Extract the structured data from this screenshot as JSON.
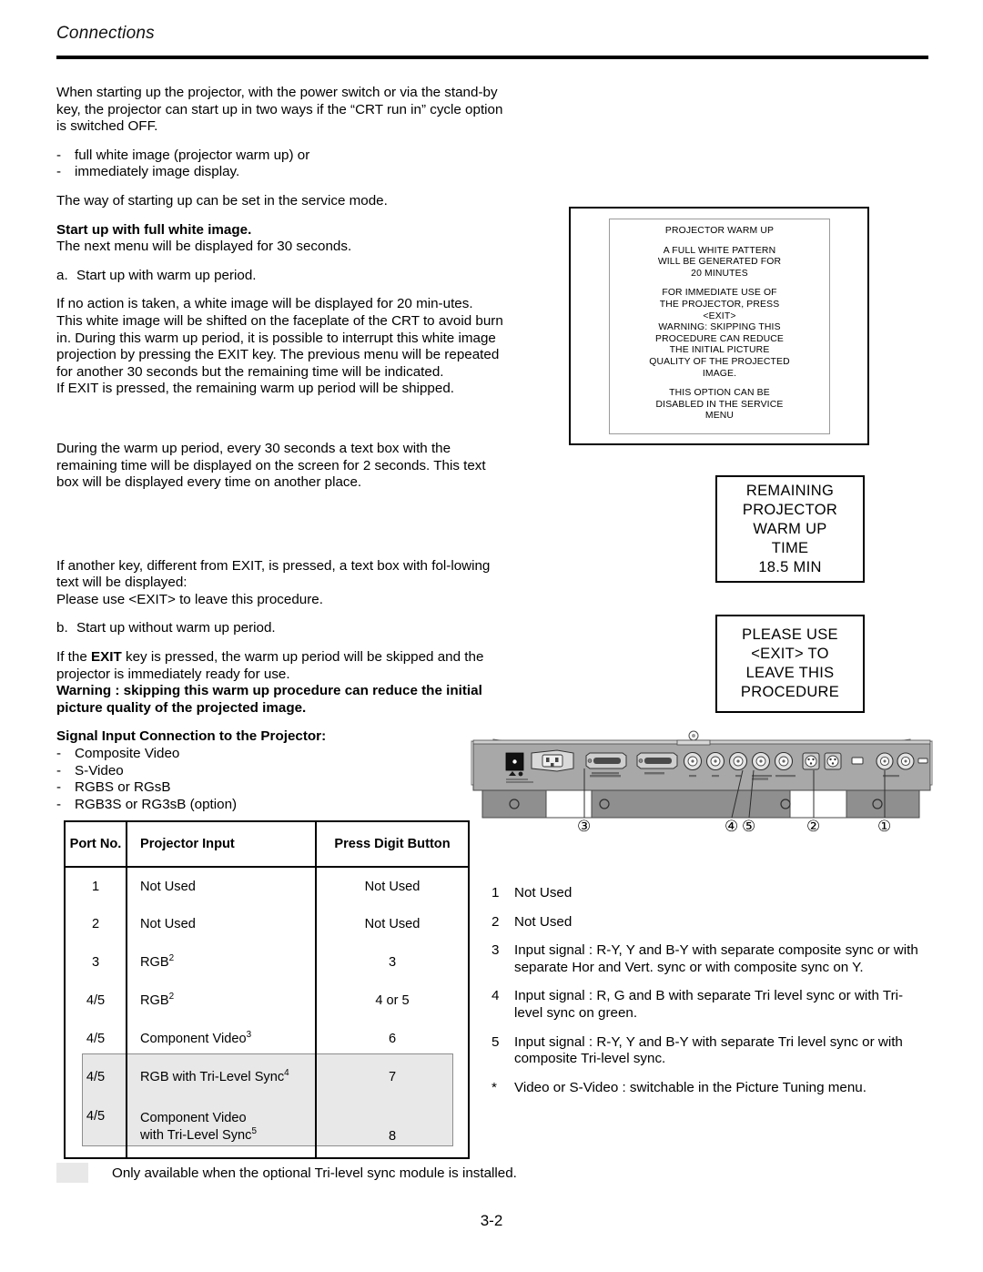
{
  "header": {
    "chapter": "Connections"
  },
  "body": {
    "intro": "When starting up the projector, with the power switch or via the stand-by key, the projector can start up in two ways if the “CRT run in” cycle option is switched OFF.",
    "intro_items": [
      "full white image (projector warm up) or",
      "immediately image display."
    ],
    "service_mode": "The way of starting up can be set in the service mode.",
    "heading_full_white": "Start up with full white image.",
    "next_menu": "The next menu will be displayed for 30 seconds.",
    "item_a_letter": "a.",
    "item_a_text": "Start up with warm up period.",
    "para_no_action": "If no action is taken, a white image will be displayed for 20 min-utes.",
    "para_shift": "This white image will be shifted on the faceplate of the CRT to avoid burn in. During this warm up period, it is possible to interrupt this white image projection by pressing the EXIT key. The previous menu will be repeated for another 30 seconds but the remaining time will be indicated.",
    "para_exit_shipped": "If EXIT is pressed, the remaining warm up period will be shipped.",
    "para_every30": "During the warm up period, every 30 seconds a text box with the remaining time will be displayed on the screen for 2 seconds. This text box will be displayed every time on another place.",
    "para_another_key": "If another key, different from EXIT, is pressed, a text box with fol-lowing text will be displayed:",
    "para_please_use": "Please use <EXIT> to leave this procedure.",
    "item_b_letter": "b.",
    "item_b_text": "Start up without warm up period.",
    "para_exit_pressed_pre": "If the ",
    "para_exit_pressed_bold": "EXIT",
    "para_exit_pressed_post": " key is pressed, the warm up period will be skipped and the projector is immediately ready for use.",
    "warning_bold": "Warning : skipping this warm up procedure can reduce the initial picture quality of the projected image.",
    "signal_heading": "Signal Input Connection to the Projector:",
    "signal_items": [
      "Composite Video",
      "S-Video",
      "RGBS or RGsB",
      "RGB3S or RG3sB (option)"
    ]
  },
  "warmup_menu": {
    "title": "PROJECTOR WARM UP",
    "block1": [
      "A FULL WHITE PATTERN",
      "WILL BE GENERATED FOR",
      "20 MINUTES"
    ],
    "block2": [
      "FOR IMMEDIATE USE OF",
      "THE PROJECTOR, PRESS",
      "<EXIT>",
      "WARNING: SKIPPING THIS",
      "PROCEDURE CAN REDUCE",
      "THE INITIAL PICTURE",
      "QUALITY OF THE PROJECTED",
      "IMAGE."
    ],
    "block3": [
      "THIS OPTION CAN BE",
      "DISABLED IN THE SERVICE",
      "MENU"
    ]
  },
  "osd_remaining": {
    "lines": [
      "REMAINING",
      "PROJECTOR",
      "WARM UP",
      "TIME",
      "18.5 MIN"
    ]
  },
  "osd_please_use": {
    "lines": [
      "PLEASE USE",
      "<EXIT> TO",
      "LEAVE THIS",
      "PROCEDURE"
    ]
  },
  "panel_figure": {
    "callouts": [
      "③",
      "④",
      "⑤",
      "②",
      "①"
    ]
  },
  "table": {
    "headers": [
      "Port No.",
      "Projector Input",
      "Press Digit Button"
    ],
    "rows": [
      {
        "port": "1",
        "input": "Not Used",
        "input_sup": "",
        "digit": "Not Used",
        "shaded": false
      },
      {
        "port": "2",
        "input": "Not Used",
        "input_sup": "",
        "digit": "Not Used",
        "shaded": false
      },
      {
        "port": "3",
        "input": "RGB",
        "input_sup": "2",
        "digit": "3",
        "shaded": false
      },
      {
        "port": "4/5",
        "input": "RGB",
        "input_sup": "2",
        "digit": "4 or 5",
        "shaded": false
      },
      {
        "port": "4/5",
        "input": "Component Video",
        "input_sup": "3",
        "digit": "6",
        "shaded": false
      },
      {
        "port": "4/5",
        "input": "RGB with Tri-Level Sync",
        "input_sup": "4",
        "digit": "7",
        "shaded": true
      },
      {
        "port": "4/5",
        "input": "Component Video",
        "input_sup": "",
        "input_line2": "with Tri-Level Sync",
        "input_line2_sup": "5",
        "digit": "8",
        "shaded": true
      }
    ]
  },
  "notes": [
    {
      "num": "1",
      "text": "Not Used"
    },
    {
      "num": "2",
      "text": "Not Used"
    },
    {
      "num": "3",
      "text": "Input signal : R-Y, Y and B-Y with separate composite sync or with separate Hor and Vert. sync or with composite sync on Y."
    },
    {
      "num": "4",
      "text": "Input signal : R, G and B with separate Tri level sync or with Tri-level sync on green."
    },
    {
      "num": "5",
      "text": "Input signal : R-Y, Y and B-Y with separate Tri level sync or with composite Tri-level sync."
    },
    {
      "num": "*",
      "text": "Video or S-Video : switchable in the Picture Tuning menu."
    }
  ],
  "footnote": {
    "text": "Only available when the optional Tri-level sync module is installed."
  },
  "page_number": "3-2",
  "colors": {
    "shade": "#e8e8e8",
    "rule": "#000000",
    "panel_body": "#a8a8a8"
  }
}
